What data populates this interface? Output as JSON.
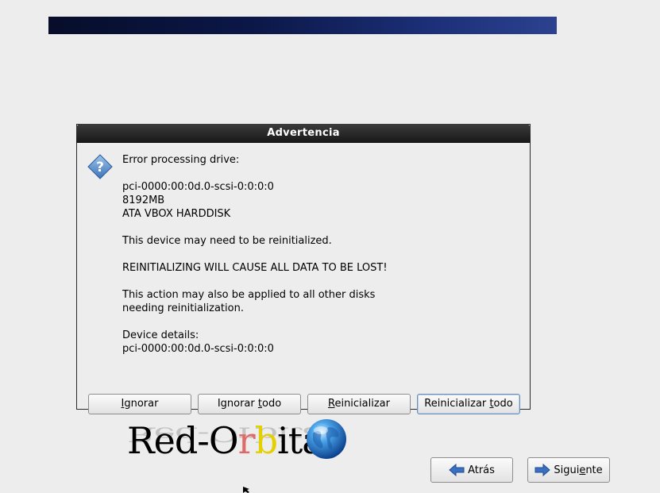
{
  "dialog": {
    "title": "Advertencia",
    "icon": "question-icon",
    "message_lines": [
      "Error processing drive:",
      "",
      "pci-0000:00:0d.0-scsi-0:0:0:0",
      "8192MB",
      "ATA VBOX HARDDISK",
      "",
      "This device may need to be reinitialized.",
      "",
      "REINITIALIZING WILL CAUSE ALL DATA TO BE LOST!",
      "",
      "This action may also be applied to all other disks",
      "needing reinitialization.",
      "",
      "Device details:",
      "pci-0000:00:0d.0-scsi-0:0:0:0"
    ],
    "buttons": {
      "ignore": {
        "pre": "",
        "mnemonic": "I",
        "post": "gnorar"
      },
      "ignore_all": {
        "pre": "Ignorar ",
        "mnemonic": "t",
        "post": "odo"
      },
      "reinit": {
        "pre": "",
        "mnemonic": "R",
        "post": "einicializar"
      },
      "reinit_all": {
        "pre": "Reinicializar ",
        "mnemonic": "t",
        "post": "odo"
      }
    }
  },
  "logo": {
    "part1": "Red-O",
    "part2": "r",
    "part3": "b",
    "part4": "ita",
    "colors": {
      "r": "#e06a6a",
      "b": "#e3d000"
    }
  },
  "nav": {
    "back": {
      "label": "Atrás",
      "icon": "arrow-left-icon"
    },
    "next": {
      "pre": "Sigui",
      "mnemonic": "e",
      "post": "nte",
      "icon": "arrow-right-icon"
    }
  }
}
